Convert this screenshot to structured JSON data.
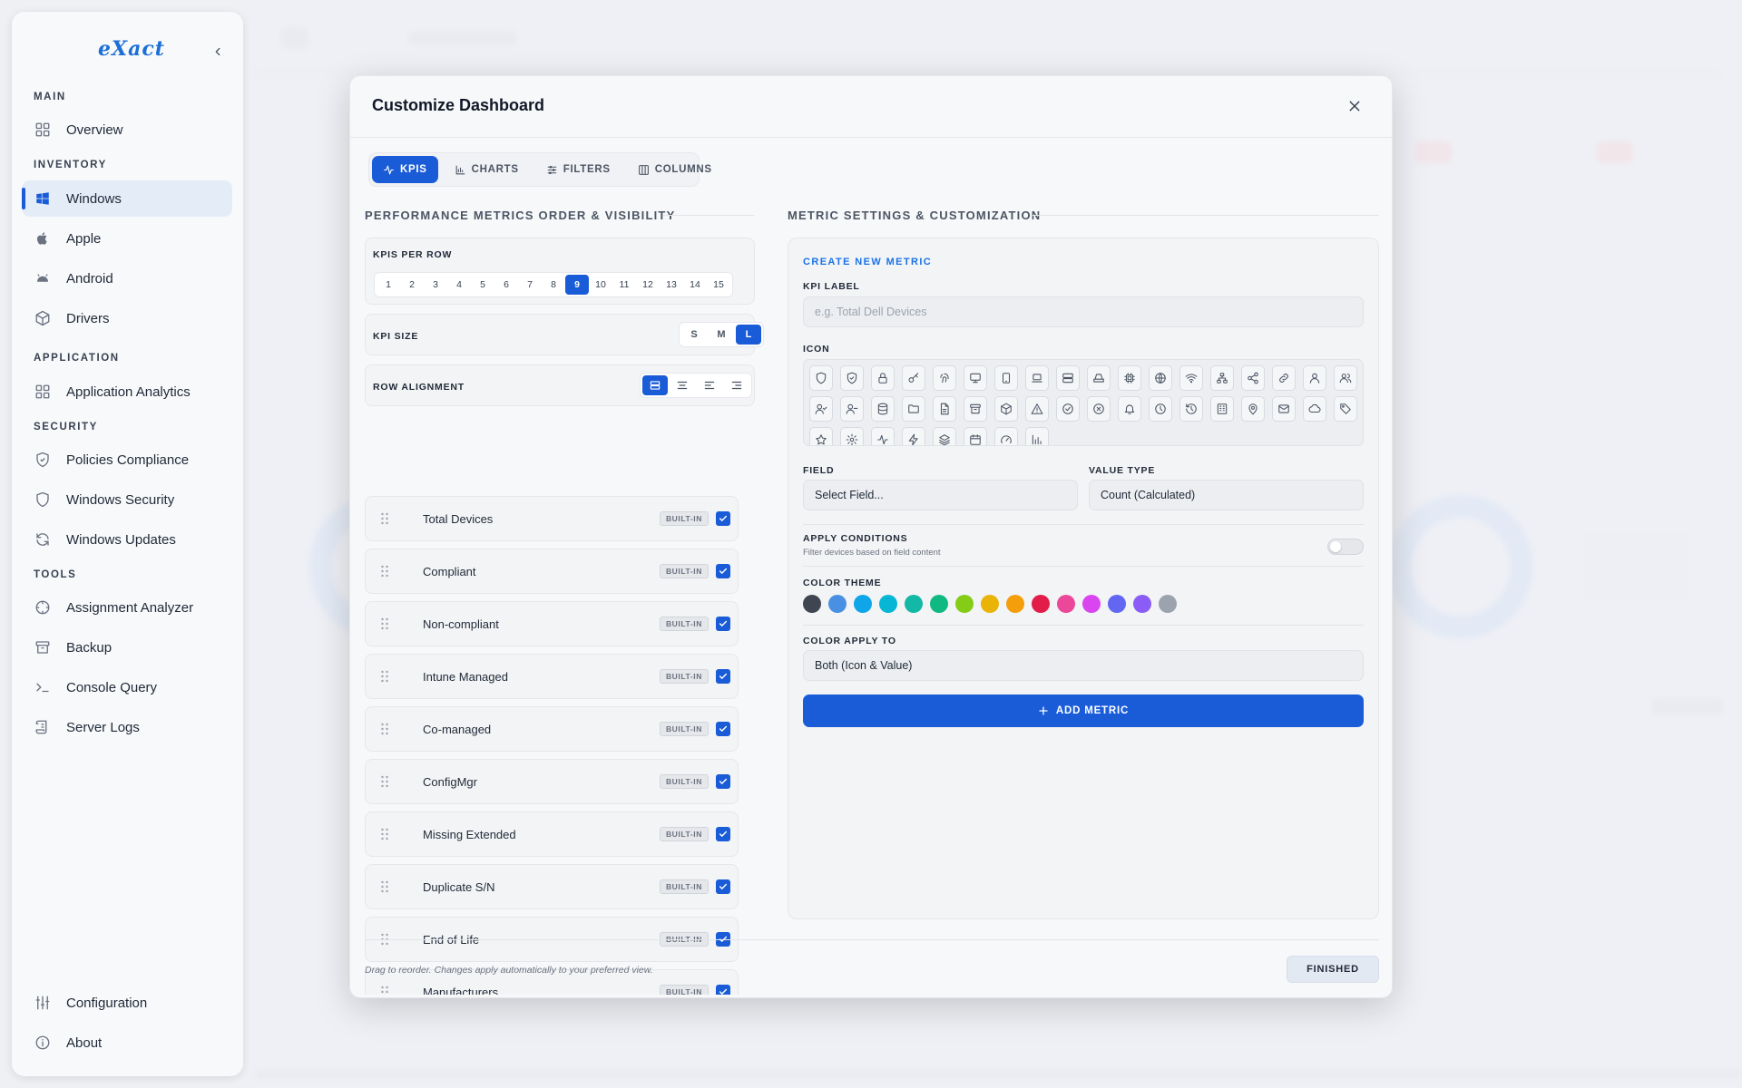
{
  "sidebar": {
    "logo": "eXact",
    "sections": {
      "main": "MAIN",
      "inventory": "INVENTORY",
      "application": "APPLICATION",
      "security": "SECURITY",
      "tools": "TOOLS"
    },
    "items": {
      "overview": "Overview",
      "windows": "Windows",
      "apple": "Apple",
      "android": "Android",
      "drivers": "Drivers",
      "app_analytics": "Application Analytics",
      "policies": "Policies Compliance",
      "win_security": "Windows Security",
      "win_updates": "Windows Updates",
      "assignment": "Assignment Analyzer",
      "backup": "Backup",
      "console": "Console Query",
      "server_logs": "Server Logs",
      "configuration": "Configuration",
      "about": "About"
    },
    "active_item": "Windows"
  },
  "modal": {
    "title": "Customize Dashboard",
    "tabs": [
      "KPIS",
      "CHARTS",
      "FILTERS",
      "COLUMNS"
    ],
    "active_tab": "KPIS",
    "left_title": "PERFORMANCE METRICS ORDER & VISIBILITY",
    "right_title": "METRIC SETTINGS & CUSTOMIZATION",
    "kpis_per_row": {
      "label": "KPIS PER ROW",
      "options": [
        "1",
        "2",
        "3",
        "4",
        "5",
        "6",
        "7",
        "8",
        "9",
        "10",
        "11",
        "12",
        "13",
        "14",
        "15"
      ],
      "selected": "9"
    },
    "kpi_size": {
      "label": "KPI SIZE",
      "options": [
        "S",
        "M",
        "L"
      ],
      "selected": "L"
    },
    "row_alignment": {
      "label": "ROW ALIGNMENT",
      "options": [
        "stretch",
        "center",
        "left",
        "right"
      ],
      "selected": "stretch"
    },
    "builtin_badge": "BUILT-IN",
    "kpis": [
      {
        "name": "Total Devices",
        "checked": true
      },
      {
        "name": "Compliant",
        "checked": true
      },
      {
        "name": "Non-compliant",
        "checked": true
      },
      {
        "name": "Intune Managed",
        "checked": true
      },
      {
        "name": "Co-managed",
        "checked": true
      },
      {
        "name": "ConfigMgr",
        "checked": true
      },
      {
        "name": "Missing Extended",
        "checked": true
      },
      {
        "name": "Duplicate S/N",
        "checked": true
      },
      {
        "name": "End of Life",
        "checked": true
      },
      {
        "name": "Manufacturers",
        "checked": true
      }
    ],
    "create": {
      "title": "CREATE NEW METRIC",
      "kpi_label": "KPI LABEL",
      "kpi_placeholder": "e.g. Total Dell Devices",
      "icon_label": "ICON",
      "field_label": "FIELD",
      "field_value": "Select Field...",
      "value_type_label": "VALUE TYPE",
      "value_type_value": "Count (Calculated)",
      "conditions_label": "APPLY CONDITIONS",
      "conditions_sub": "Filter devices based on field content",
      "color_theme_label": "COLOR THEME",
      "colors": [
        "#3f4652",
        "#4a90e2",
        "#0ea5e9",
        "#06b6d4",
        "#14b8a6",
        "#10b981",
        "#84cc16",
        "#eab308",
        "#f59e0b",
        "#e11d48",
        "#ec4899",
        "#d946ef",
        "#6366f1",
        "#8b5cf6",
        "#9ca3af"
      ],
      "color_apply_label": "COLOR APPLY TO",
      "color_apply_value": "Both (Icon & Value)",
      "add_button": "ADD METRIC"
    },
    "icons": [
      "shield",
      "shield-check",
      "lock",
      "key",
      "fingerprint",
      "monitor",
      "tablet",
      "laptop",
      "server",
      "hard-drive",
      "cpu",
      "globe",
      "wifi",
      "network",
      "share",
      "link",
      "user",
      "users",
      "user-check",
      "user-minus",
      "database",
      "folder",
      "file",
      "archive",
      "package",
      "alert-triangle",
      "check-circle",
      "x-circle",
      "bell",
      "clock",
      "history",
      "building",
      "map-pin",
      "mail",
      "cloud",
      "tag",
      "star",
      "settings",
      "activity",
      "zap",
      "layers",
      "calendar",
      "gauge",
      "bar-chart"
    ],
    "footer_note": "Drag to reorder. Changes apply automatically to your preferred view.",
    "finish_button": "FINISHED"
  }
}
